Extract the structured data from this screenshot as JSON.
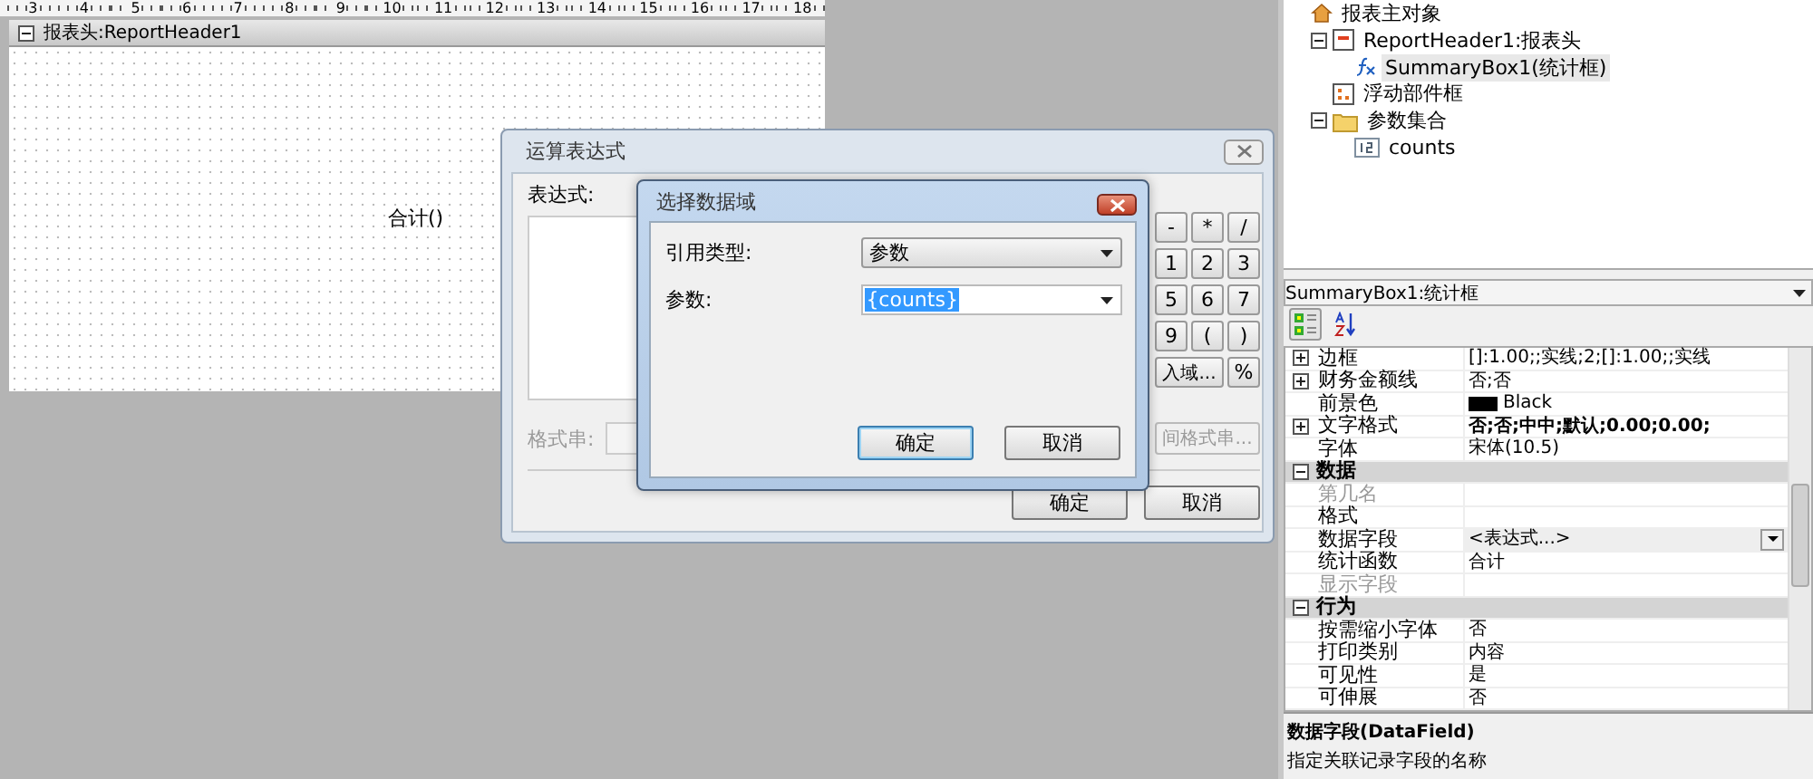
{
  "ruler": {
    "marks": [
      "3",
      "4",
      "5",
      "6",
      "7",
      "8",
      "9",
      "10",
      "11",
      "12",
      "13",
      "14",
      "15",
      "16",
      "17",
      "18"
    ]
  },
  "report_section": {
    "title": "报表头:ReportHeader1",
    "expanded": true,
    "fields": [
      {
        "text": "合计()"
      }
    ]
  },
  "expression_dialog": {
    "title": "运算表达式",
    "expression_label": "表达式:",
    "keypad": [
      "-",
      "*",
      "/",
      "1",
      "2",
      "3",
      "5",
      "6",
      "7",
      "9",
      "(",
      ")"
    ],
    "insert_field_button": "入域...",
    "percent_button": "%",
    "format_field": {
      "label": "格式串:",
      "disabled": true
    },
    "time_format_button": "间格式串...",
    "buttons": [
      "确定",
      "取消"
    ]
  },
  "data_field_dialog": {
    "title": "选择数据域",
    "reference_type": {
      "label": "引用类型:",
      "value": "参数"
    },
    "parameter": {
      "label": "参数:",
      "value": "{counts}",
      "selected": true
    },
    "buttons": [
      {
        "label": "确定",
        "focused": true
      },
      {
        "label": "取消",
        "focused": false
      }
    ]
  },
  "object_tree": {
    "items": [
      {
        "label": "报表主对象",
        "kind": "home",
        "selected": false,
        "children": [
          {
            "label": "ReportHeader1:报表头",
            "kind": "section",
            "selected": false,
            "expanded": true,
            "children": [
              {
                "label": "SummaryBox1(统计框)",
                "kind": "function",
                "selected": true
              }
            ]
          },
          {
            "label": "浮动部件框",
            "kind": "float",
            "selected": false
          },
          {
            "label": "参数集合",
            "kind": "folder",
            "selected": false,
            "expanded": true,
            "children": [
              {
                "label": "counts",
                "kind": "number",
                "selected": false
              }
            ]
          }
        ]
      }
    ]
  },
  "object_selector": {
    "value": "SummaryBox1:统计框"
  },
  "property_toolbar": {
    "buttons": [
      {
        "kind": "categorized",
        "selected": true
      },
      {
        "kind": "alphabetical",
        "selected": false
      }
    ]
  },
  "properties": {
    "rows": [
      {
        "kind": "property",
        "name": "边框",
        "value": "[]:1.00;;实线;2;[]:1.00;;实线",
        "expanded": false,
        "disabled": false,
        "selected": false,
        "bold": false
      },
      {
        "kind": "property",
        "name": "财务金额线",
        "value": "否;否",
        "expanded": false,
        "disabled": false,
        "selected": false,
        "bold": false
      },
      {
        "kind": "property",
        "name": "前景色",
        "value": "Black",
        "color": "#000000",
        "disabled": false,
        "selected": false,
        "bold": false
      },
      {
        "kind": "property",
        "name": "文字格式",
        "value": "否;否;中中;默认;0.00;0.00;",
        "expanded": false,
        "disabled": false,
        "selected": false,
        "bold": true
      },
      {
        "kind": "property",
        "name": "字体",
        "value": "宋体(10.5)",
        "disabled": false,
        "selected": false,
        "bold": false
      },
      {
        "kind": "category",
        "name": "数据",
        "expanded": true
      },
      {
        "kind": "property",
        "name": "第几名",
        "value": "",
        "disabled": true,
        "selected": false
      },
      {
        "kind": "property",
        "name": "格式",
        "value": "",
        "disabled": false,
        "selected": false
      },
      {
        "kind": "property",
        "name": "数据字段",
        "value": "<表达式...>",
        "disabled": false,
        "selected": true,
        "bold": false
      },
      {
        "kind": "property",
        "name": "统计函数",
        "value": "合计",
        "disabled": false,
        "selected": false,
        "bold": false
      },
      {
        "kind": "property",
        "name": "显示字段",
        "value": "",
        "disabled": true,
        "selected": false
      },
      {
        "kind": "category",
        "name": "行为",
        "expanded": true
      },
      {
        "kind": "property",
        "name": "按需缩小字体",
        "value": "否",
        "disabled": false,
        "selected": false,
        "bold": false
      },
      {
        "kind": "property",
        "name": "打印类别",
        "value": "内容",
        "disabled": false,
        "selected": false,
        "bold": false
      },
      {
        "kind": "property",
        "name": "可见性",
        "value": "是",
        "disabled": false,
        "selected": false,
        "bold": false
      },
      {
        "kind": "property",
        "name": "可伸展",
        "value": "否",
        "disabled": false,
        "selected": false,
        "bold": false
      }
    ]
  },
  "description": {
    "title": "数据字段(DataField)",
    "text": "指定关联记录字段的名称"
  }
}
